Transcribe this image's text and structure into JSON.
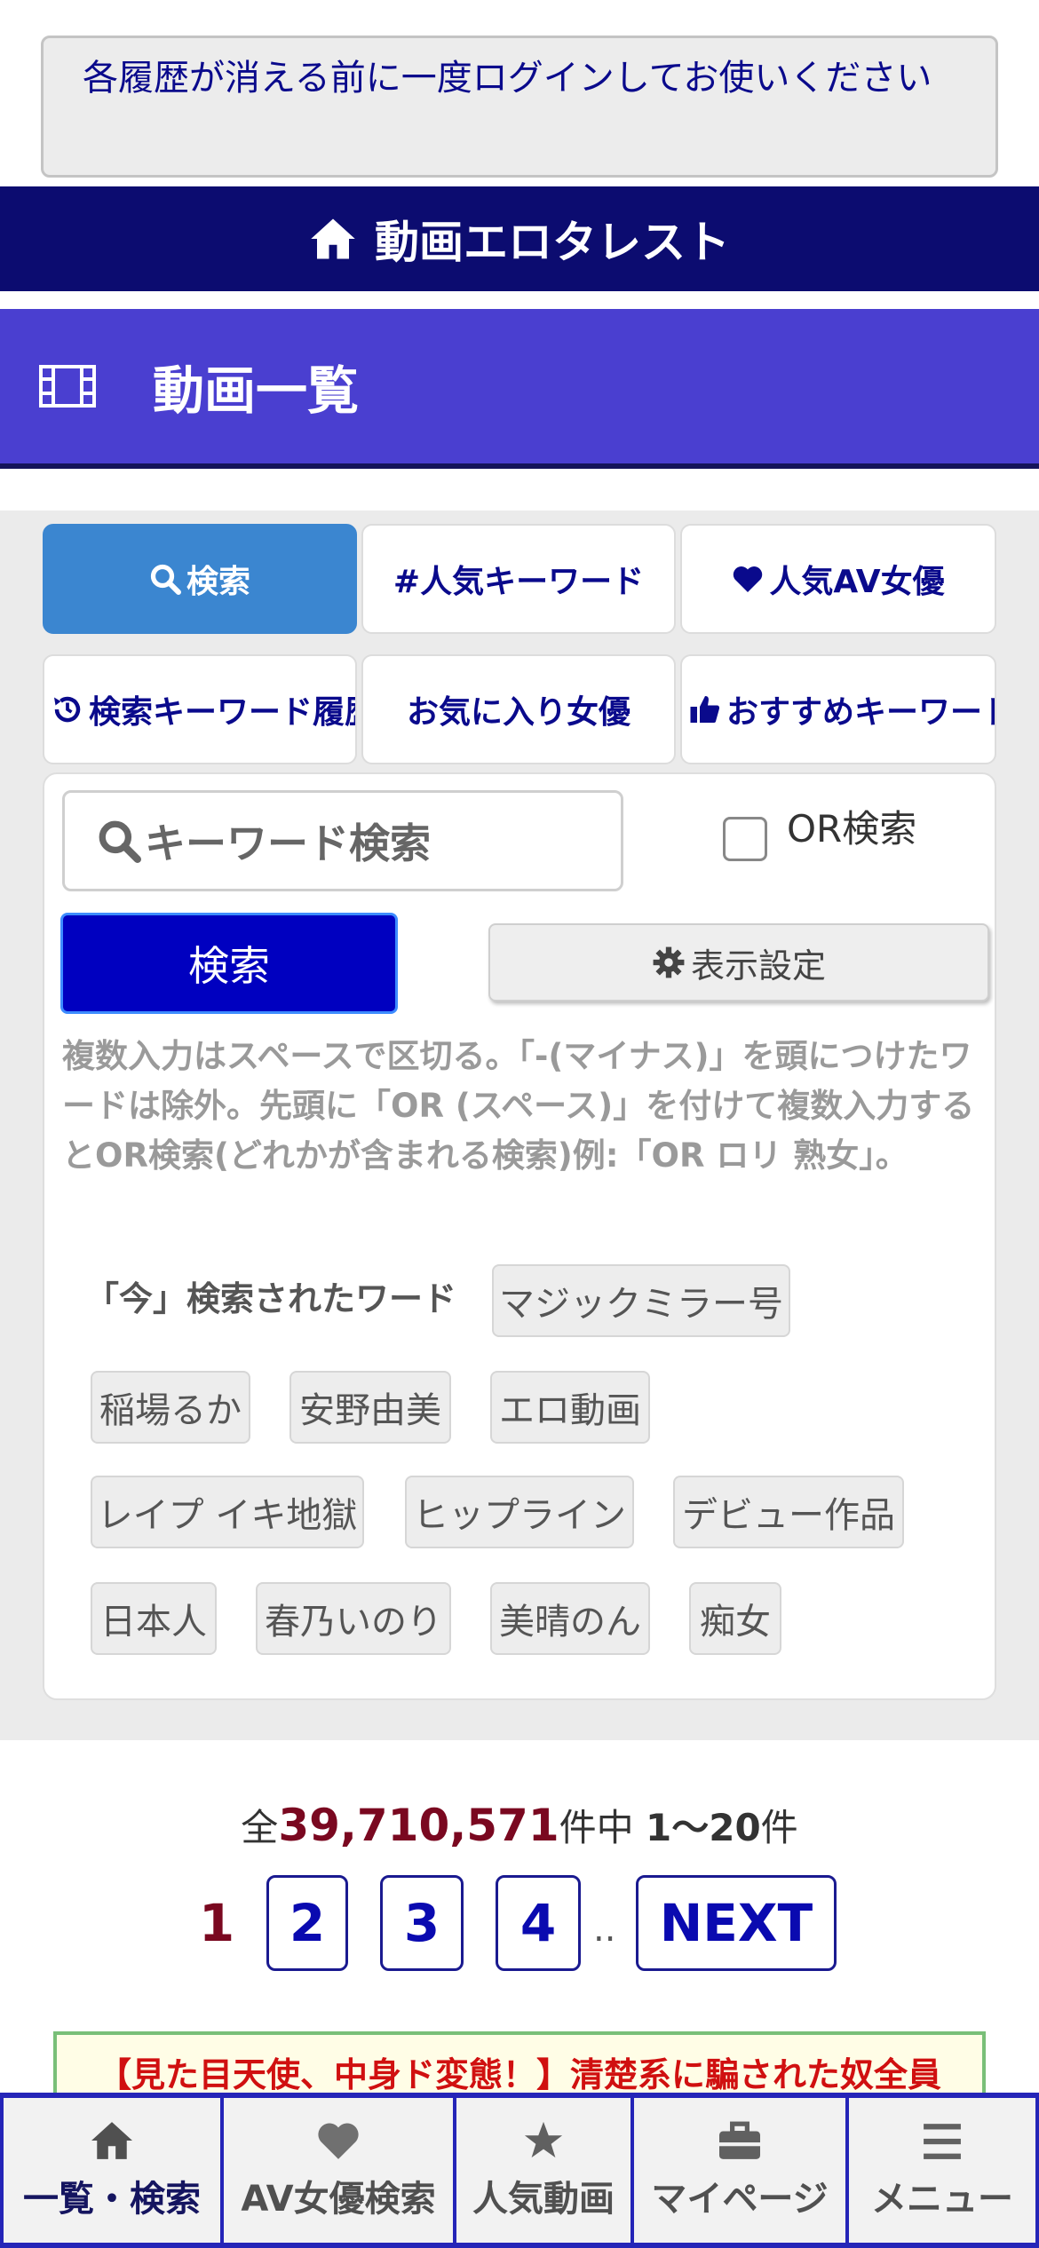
{
  "notice": {
    "text": "各履歴が消える前に一度ログインしてお使いください"
  },
  "header": {
    "title": "動画エロタレスト",
    "icon": "home-icon"
  },
  "page": {
    "title": "動画一覧",
    "icon": "film-icon"
  },
  "tabs": [
    {
      "label": "検索",
      "icon": "search-icon",
      "active": true
    },
    {
      "label": "#人気キーワード",
      "icon": ""
    },
    {
      "label": "人気AV女優",
      "icon": "heart-icon"
    },
    {
      "label": "検索キーワード履歴",
      "icon": "history-icon"
    },
    {
      "label": "お気に入り女優",
      "icon": ""
    },
    {
      "label": "おすすめキーワード",
      "icon": "thumbs-up-icon"
    }
  ],
  "search": {
    "placeholder": "キーワード検索",
    "or_label": "OR検索",
    "submit_label": "検索",
    "display_settings_label": "表示設定",
    "help_text": "複数入力はスペースで区切る。「-(マイナス)」を頭につけたワードは除外。先頭に「OR (スペース)」を付けて複数入力するとOR検索(どれかが含まれる検索)例:「OR ロリ 熟女」。"
  },
  "trending": {
    "label": "「今」検索されたワード",
    "words": [
      "マジックミラー号",
      "稲場るか",
      "安野由美",
      "エロ動画",
      "レイプ イキ地獄",
      "ヒップライン",
      "デビュー作品",
      "日本人",
      "春乃いのり",
      "美晴のん",
      "痴女"
    ]
  },
  "results": {
    "prefix": "全",
    "total": "39,710,571",
    "middle": "件中",
    "range": "1〜20",
    "suffix": "件"
  },
  "pagination": {
    "pages": [
      "1",
      "2",
      "3",
      "4"
    ],
    "current": "1",
    "ellipsis": "..",
    "next": "NEXT"
  },
  "ad": {
    "text": "【見た目天使、中身ド変態！】清楚系に騙された奴全員"
  },
  "bottom_nav": [
    {
      "label": "一覧・検索",
      "icon": "home-icon",
      "active": true
    },
    {
      "label": "AV女優検索",
      "icon": "heart-icon"
    },
    {
      "label": "人気動画",
      "icon": "star-icon"
    },
    {
      "label": "マイページ",
      "icon": "briefcase-icon"
    },
    {
      "label": "メニュー",
      "icon": "menu-icon"
    }
  ],
  "colors": {
    "header": "#0c0c70",
    "page_head": "#4a3fd0",
    "active_tab": "#3b86d0",
    "primary_button": "#0000c0",
    "count_accent": "#7a0820",
    "nav_border": "#2525b8"
  }
}
